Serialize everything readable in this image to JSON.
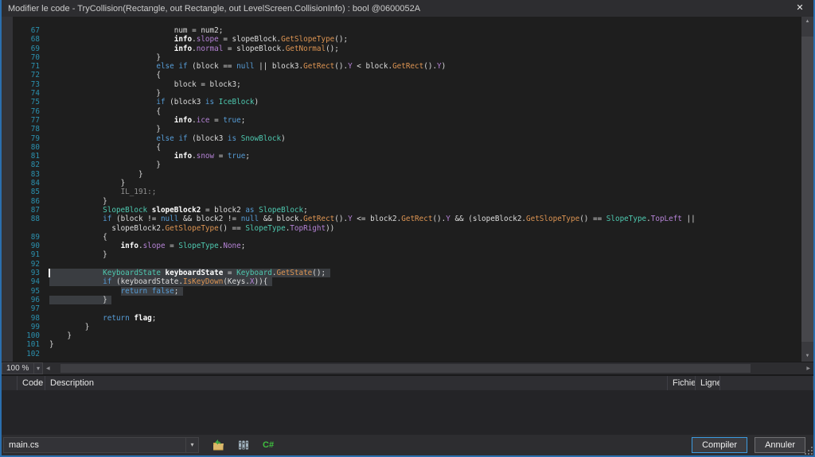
{
  "window": {
    "title": "Modifier le code - TryCollision(Rectangle, out Rectangle, out LevelScreen.CollisionInfo) : bool @0600052A",
    "close_icon": "✕"
  },
  "icons": {
    "dropdown": "▾",
    "scroll_up": "▲",
    "scroll_down": "▼",
    "scroll_left": "◀",
    "scroll_right": "▶"
  },
  "colors": {
    "window_border": "#2b6fae",
    "editor_background": "#1e1e1e",
    "titlebar_background": "#2d2d30",
    "selection": "#3a3d41",
    "line_number": "#2b91af",
    "keyword": "#569cd6",
    "type": "#4ec9b0",
    "method": "#dd9452",
    "field": "#b583d6",
    "label": "#8f8f8f",
    "plain": "#dcdcdc",
    "primary_button_border": "#3c9be0",
    "csharp_icon_green": "#3fbf3f"
  },
  "editor": {
    "zoom_level": "100 %",
    "lines": [
      {
        "n": "67",
        "ind": 28,
        "tok": [
          [
            "p",
            "num = num2;"
          ]
        ]
      },
      {
        "n": "68",
        "ind": 28,
        "tok": [
          [
            "d",
            "info"
          ],
          [
            "p",
            "."
          ],
          [
            "f",
            "slope"
          ],
          [
            "p",
            " = slopeBlock."
          ],
          [
            "m",
            "GetSlopeType"
          ],
          [
            "p",
            "();"
          ]
        ]
      },
      {
        "n": "69",
        "ind": 28,
        "tok": [
          [
            "d",
            "info"
          ],
          [
            "p",
            "."
          ],
          [
            "f",
            "normal"
          ],
          [
            "p",
            " = slopeBlock."
          ],
          [
            "m",
            "GetNormal"
          ],
          [
            "p",
            "();"
          ]
        ]
      },
      {
        "n": "70",
        "ind": 24,
        "tok": [
          [
            "p",
            "}"
          ]
        ]
      },
      {
        "n": "71",
        "ind": 24,
        "tok": [
          [
            "k",
            "else"
          ],
          [
            "p",
            " "
          ],
          [
            "k",
            "if"
          ],
          [
            "p",
            " (block == "
          ],
          [
            "k",
            "null"
          ],
          [
            "p",
            " || block3."
          ],
          [
            "m",
            "GetRect"
          ],
          [
            "p",
            "()."
          ],
          [
            "f",
            "Y"
          ],
          [
            "p",
            " < block."
          ],
          [
            "m",
            "GetRect"
          ],
          [
            "p",
            "()."
          ],
          [
            "f",
            "Y"
          ],
          [
            "p",
            ")"
          ]
        ]
      },
      {
        "n": "72",
        "ind": 24,
        "tok": [
          [
            "p",
            "{"
          ]
        ]
      },
      {
        "n": "73",
        "ind": 28,
        "tok": [
          [
            "p",
            "block = block3;"
          ]
        ]
      },
      {
        "n": "74",
        "ind": 24,
        "tok": [
          [
            "p",
            "}"
          ]
        ]
      },
      {
        "n": "75",
        "ind": 24,
        "tok": [
          [
            "k",
            "if"
          ],
          [
            "p",
            " (block3 "
          ],
          [
            "k",
            "is"
          ],
          [
            "p",
            " "
          ],
          [
            "t",
            "IceBlock"
          ],
          [
            "p",
            ")"
          ]
        ]
      },
      {
        "n": "76",
        "ind": 24,
        "tok": [
          [
            "p",
            "{"
          ]
        ]
      },
      {
        "n": "77",
        "ind": 28,
        "tok": [
          [
            "d",
            "info"
          ],
          [
            "p",
            "."
          ],
          [
            "f",
            "ice"
          ],
          [
            "p",
            " = "
          ],
          [
            "k",
            "true"
          ],
          [
            "p",
            ";"
          ]
        ]
      },
      {
        "n": "78",
        "ind": 24,
        "tok": [
          [
            "p",
            "}"
          ]
        ]
      },
      {
        "n": "79",
        "ind": 24,
        "tok": [
          [
            "k",
            "else"
          ],
          [
            "p",
            " "
          ],
          [
            "k",
            "if"
          ],
          [
            "p",
            " (block3 "
          ],
          [
            "k",
            "is"
          ],
          [
            "p",
            " "
          ],
          [
            "t",
            "SnowBlock"
          ],
          [
            "p",
            ")"
          ]
        ]
      },
      {
        "n": "80",
        "ind": 24,
        "tok": [
          [
            "p",
            "{"
          ]
        ]
      },
      {
        "n": "81",
        "ind": 28,
        "tok": [
          [
            "d",
            "info"
          ],
          [
            "p",
            "."
          ],
          [
            "f",
            "snow"
          ],
          [
            "p",
            " = "
          ],
          [
            "k",
            "true"
          ],
          [
            "p",
            ";"
          ]
        ]
      },
      {
        "n": "82",
        "ind": 24,
        "tok": [
          [
            "p",
            "}"
          ]
        ]
      },
      {
        "n": "83",
        "ind": 20,
        "tok": [
          [
            "p",
            "}"
          ]
        ]
      },
      {
        "n": "84",
        "ind": 16,
        "tok": [
          [
            "p",
            "}"
          ]
        ]
      },
      {
        "n": "85",
        "ind": 16,
        "tok": [
          [
            "l",
            "IL_191:;"
          ]
        ]
      },
      {
        "n": "86",
        "ind": 12,
        "tok": [
          [
            "p",
            "}"
          ]
        ]
      },
      {
        "n": "87",
        "ind": 12,
        "tok": [
          [
            "t",
            "SlopeBlock"
          ],
          [
            "p",
            " "
          ],
          [
            "d",
            "slopeBlock2"
          ],
          [
            "p",
            " = block2 "
          ],
          [
            "k",
            "as"
          ],
          [
            "p",
            " "
          ],
          [
            "t",
            "SlopeBlock"
          ],
          [
            "p",
            ";"
          ]
        ]
      },
      {
        "n": "88",
        "ind": 12,
        "tok": [
          [
            "k",
            "if"
          ],
          [
            "p",
            " (block != "
          ],
          [
            "k",
            "null"
          ],
          [
            "p",
            " && block2 != "
          ],
          [
            "k",
            "null"
          ],
          [
            "p",
            " && block."
          ],
          [
            "m",
            "GetRect"
          ],
          [
            "p",
            "()."
          ],
          [
            "f",
            "Y"
          ],
          [
            "p",
            " <= block2."
          ],
          [
            "m",
            "GetRect"
          ],
          [
            "p",
            "()."
          ],
          [
            "f",
            "Y"
          ],
          [
            "p",
            " && (slopeBlock2."
          ],
          [
            "m",
            "GetSlopeType"
          ],
          [
            "p",
            "() == "
          ],
          [
            "t",
            "SlopeType"
          ],
          [
            "p",
            "."
          ],
          [
            "f",
            "TopLeft"
          ],
          [
            "p",
            " ||"
          ]
        ]
      },
      {
        "n": "",
        "ind": 14,
        "tok": [
          [
            "p",
            "slopeBlock2."
          ],
          [
            "m",
            "GetSlopeType"
          ],
          [
            "p",
            "() == "
          ],
          [
            "t",
            "SlopeType"
          ],
          [
            "p",
            "."
          ],
          [
            "f",
            "TopRight"
          ],
          [
            "p",
            "))"
          ]
        ]
      },
      {
        "n": "89",
        "ind": 12,
        "tok": [
          [
            "p",
            "{"
          ]
        ]
      },
      {
        "n": "90",
        "ind": 16,
        "tok": [
          [
            "d",
            "info"
          ],
          [
            "p",
            "."
          ],
          [
            "f",
            "slope"
          ],
          [
            "p",
            " = "
          ],
          [
            "t",
            "SlopeType"
          ],
          [
            "p",
            "."
          ],
          [
            "f",
            "None"
          ],
          [
            "p",
            ";"
          ]
        ]
      },
      {
        "n": "91",
        "ind": 12,
        "tok": [
          [
            "p",
            "}"
          ]
        ]
      },
      {
        "n": "92",
        "ind": 0,
        "tok": []
      },
      {
        "n": "93",
        "ind": 12,
        "sel": "full",
        "caret": true,
        "tok": [
          [
            "t",
            "KeyboardState"
          ],
          [
            "p",
            " "
          ],
          [
            "d",
            "keyboardState"
          ],
          [
            "p",
            " = "
          ],
          [
            "t",
            "Keyboard"
          ],
          [
            "p",
            "."
          ],
          [
            "m",
            "GetState"
          ],
          [
            "p",
            "();"
          ]
        ]
      },
      {
        "n": "94",
        "ind": 12,
        "sel": "full",
        "tok": [
          [
            "k",
            "if"
          ],
          [
            "p",
            " (keyboardState."
          ],
          [
            "m",
            "IsKeyDown"
          ],
          [
            "p",
            "(Keys."
          ],
          [
            "f",
            "X"
          ],
          [
            "p",
            ")){"
          ]
        ]
      },
      {
        "n": "95",
        "ind": 16,
        "sel": "text",
        "tok": [
          [
            "k",
            "return"
          ],
          [
            "p",
            " "
          ],
          [
            "k",
            "false"
          ],
          [
            "p",
            ";"
          ]
        ]
      },
      {
        "n": "96",
        "ind": 12,
        "sel": "full",
        "tok": [
          [
            "p",
            "}"
          ]
        ]
      },
      {
        "n": "97",
        "ind": 0,
        "tok": []
      },
      {
        "n": "98",
        "ind": 12,
        "tok": [
          [
            "k",
            "return"
          ],
          [
            "p",
            " "
          ],
          [
            "d",
            "flag"
          ],
          [
            "p",
            ";"
          ]
        ]
      },
      {
        "n": "99",
        "ind": 8,
        "tok": [
          [
            "p",
            "}"
          ]
        ]
      },
      {
        "n": "100",
        "ind": 4,
        "tok": [
          [
            "p",
            "}"
          ]
        ]
      },
      {
        "n": "101",
        "ind": 0,
        "tok": [
          [
            "p",
            "}"
          ]
        ]
      },
      {
        "n": "102",
        "ind": 0,
        "tok": []
      }
    ]
  },
  "panel": {
    "columns": [
      "",
      "Code",
      "Description",
      "Fichier",
      "Ligne",
      ""
    ]
  },
  "footer": {
    "file_select": "main.cs",
    "csharp_icon_label": "C#",
    "compile_label": "Compiler",
    "cancel_label": "Annuler"
  }
}
